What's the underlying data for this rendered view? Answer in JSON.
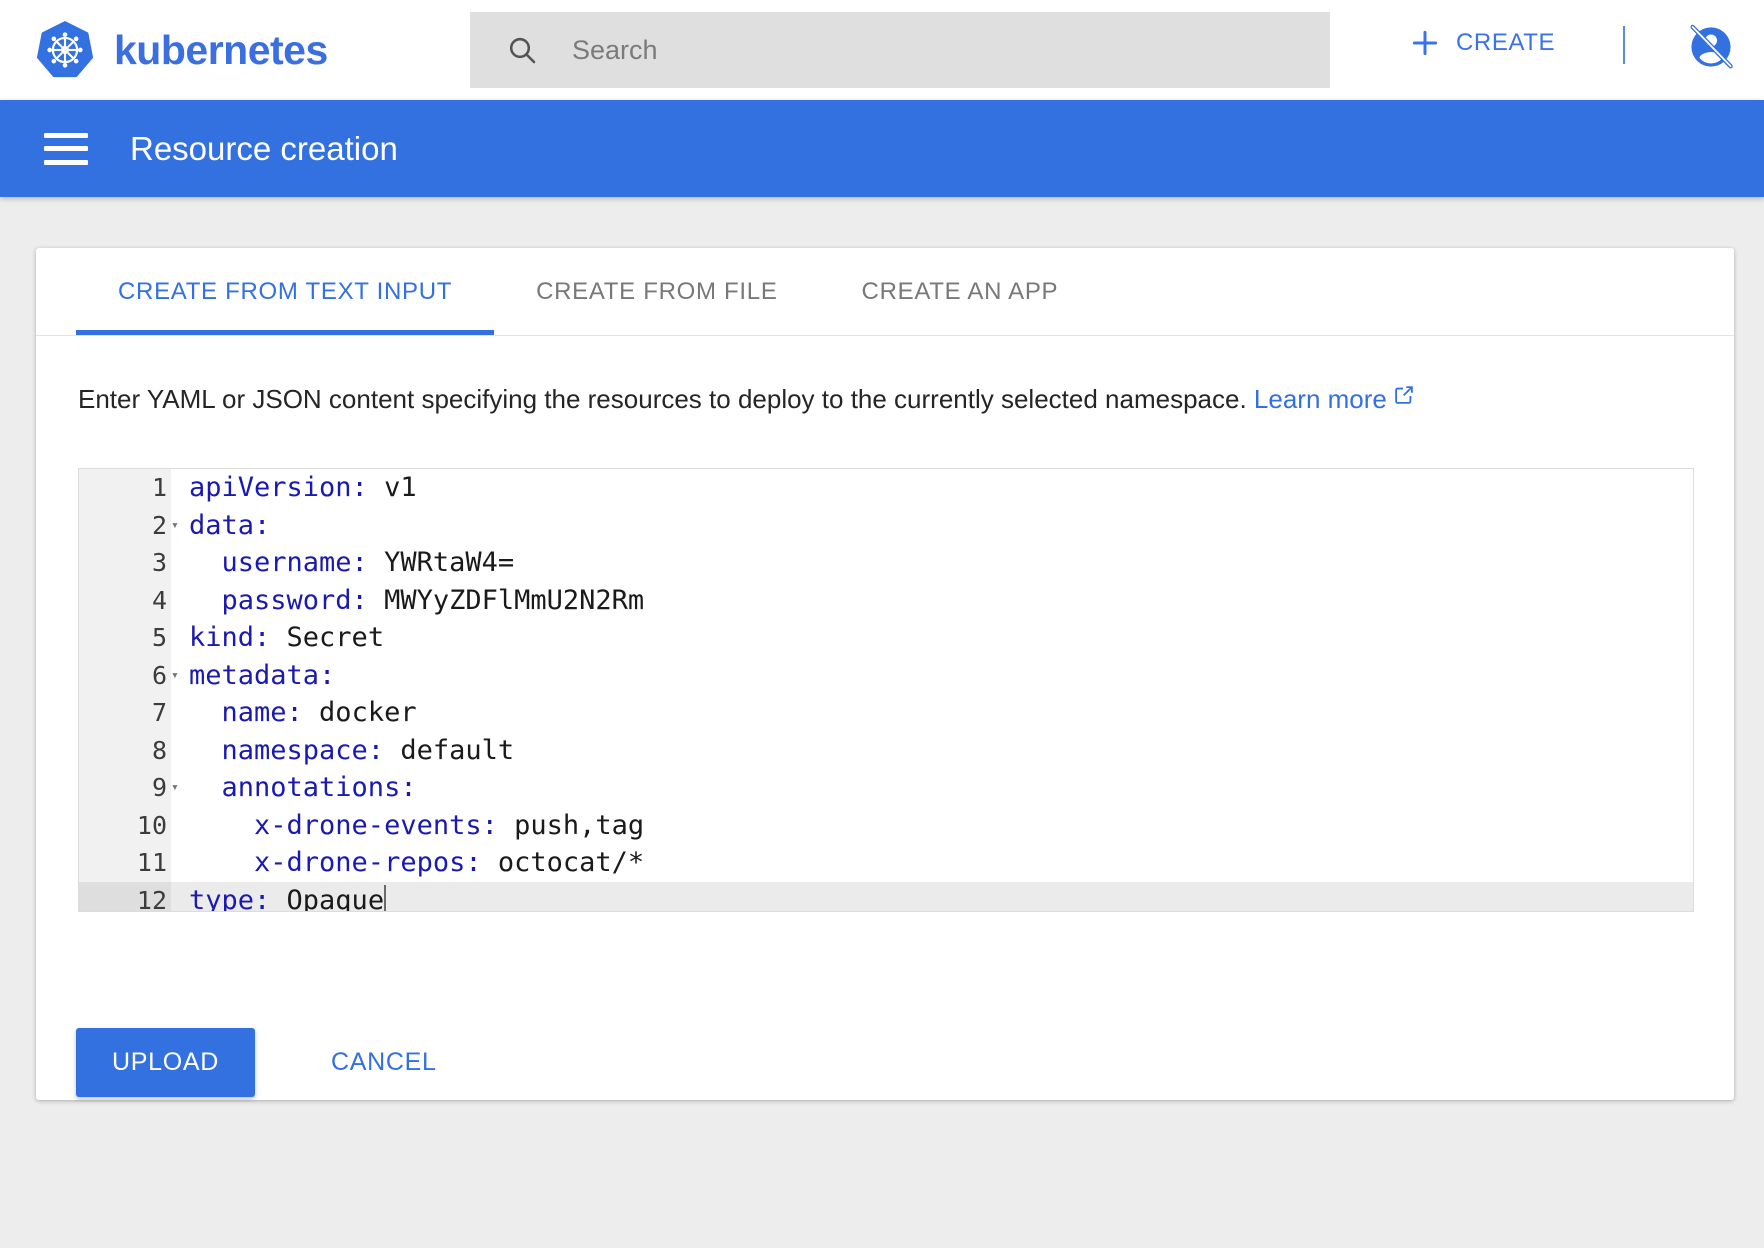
{
  "header": {
    "brand_name": "kubernetes",
    "logo_icon": "kubernetes-helm-wheel-icon",
    "search": {
      "icon": "search-icon",
      "placeholder": "Search",
      "value": ""
    },
    "create_button": {
      "icon": "plus-icon",
      "label": "CREATE"
    },
    "account_icon": "account-circle-disabled-icon"
  },
  "toolbar": {
    "menu_icon": "hamburger-menu-icon",
    "title": "Resource creation"
  },
  "tabs": [
    {
      "label": "CREATE FROM TEXT INPUT",
      "active": true
    },
    {
      "label": "CREATE FROM FILE",
      "active": false
    },
    {
      "label": "CREATE AN APP",
      "active": false
    }
  ],
  "description": {
    "text": "Enter YAML or JSON content specifying the resources to deploy to the currently selected namespace.",
    "link_label": "Learn more",
    "link_icon": "open-in-new-icon"
  },
  "editor": {
    "active_line": 12,
    "cursor_line": 12,
    "lines": [
      {
        "number": "1",
        "key": "apiVersion",
        "indent": 0,
        "value": "v1",
        "foldable": false
      },
      {
        "number": "2",
        "key": "data",
        "indent": 0,
        "value": "",
        "foldable": true
      },
      {
        "number": "3",
        "key": "username",
        "indent": 2,
        "value": "YWRtaW4=",
        "foldable": false
      },
      {
        "number": "4",
        "key": "password",
        "indent": 2,
        "value": "MWYyZDFlMmU2N2Rm",
        "foldable": false
      },
      {
        "number": "5",
        "key": "kind",
        "indent": 0,
        "value": "Secret",
        "foldable": false
      },
      {
        "number": "6",
        "key": "metadata",
        "indent": 0,
        "value": "",
        "foldable": true
      },
      {
        "number": "7",
        "key": "name",
        "indent": 2,
        "value": "docker",
        "foldable": false
      },
      {
        "number": "8",
        "key": "namespace",
        "indent": 2,
        "value": "default",
        "foldable": false
      },
      {
        "number": "9",
        "key": "annotations",
        "indent": 2,
        "value": "",
        "foldable": true
      },
      {
        "number": "10",
        "key": "x-drone-events",
        "indent": 4,
        "value": "push,tag",
        "foldable": false
      },
      {
        "number": "11",
        "key": "x-drone-repos",
        "indent": 4,
        "value": "octocat/*",
        "foldable": false
      },
      {
        "number": "12",
        "key": "type",
        "indent": 0,
        "value": "Opaque",
        "foldable": false
      }
    ]
  },
  "actions": {
    "upload_label": "UPLOAD",
    "cancel_label": "CANCEL"
  },
  "colors": {
    "accent_blue": "#3370e0",
    "page_background": "#ededed",
    "search_background": "#dfdfdf",
    "yaml_key": "#1a1ab0",
    "gutter_background": "#f1f1f1",
    "active_line_background": "#ebebeb"
  }
}
